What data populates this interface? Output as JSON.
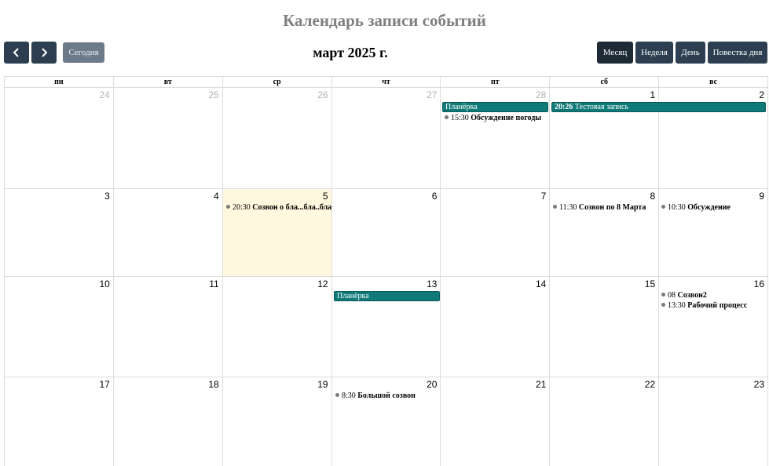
{
  "title": "Календарь записи событий",
  "toolbar": {
    "today_label": "Сегодня",
    "current_period": "март 2025 г.",
    "views": {
      "month": "Месяц",
      "week": "Неделя",
      "day": "День",
      "agenda": "Повестка дня"
    },
    "active_view": "month"
  },
  "weekdays": [
    "пн",
    "вт",
    "ср",
    "чт",
    "пт",
    "сб",
    "вс"
  ],
  "weeks": [
    {
      "days": [
        "24",
        "25",
        "26",
        "27",
        "28",
        "1",
        "2"
      ]
    },
    {
      "days": [
        "3",
        "4",
        "5",
        "6",
        "7",
        "8",
        "9"
      ]
    },
    {
      "days": [
        "10",
        "11",
        "12",
        "13",
        "14",
        "15",
        "16"
      ]
    },
    {
      "days": [
        "17",
        "18",
        "19",
        "20",
        "21",
        "22",
        "23"
      ]
    }
  ],
  "today": "5",
  "events": {
    "planerka_28": {
      "title": "Планёрка"
    },
    "test_1": {
      "time": "20:26",
      "title": "Тестовая запись"
    },
    "weather_28": {
      "time": "15:30",
      "title": "Обсуждение погоды"
    },
    "call_5": {
      "time": "20:30",
      "title": "Созвон о бла...бла..бла"
    },
    "march8": {
      "time": "11:30",
      "title": "Созвон по 8 Марта"
    },
    "discussion_9": {
      "time": "10:30",
      "title": "Обсуждение"
    },
    "planerka_13": {
      "title": "Планёрка"
    },
    "call2_16": {
      "time": "08",
      "title": "Созвон2"
    },
    "work_16": {
      "time": "13:30",
      "title": "Рабочий процесс"
    },
    "bigcall_20": {
      "time": "8:30",
      "title": "Большой созвон"
    }
  },
  "colors": {
    "event_bar": "#0f7a78",
    "button": "#2c3e50",
    "today_bg": "#fff8de"
  }
}
